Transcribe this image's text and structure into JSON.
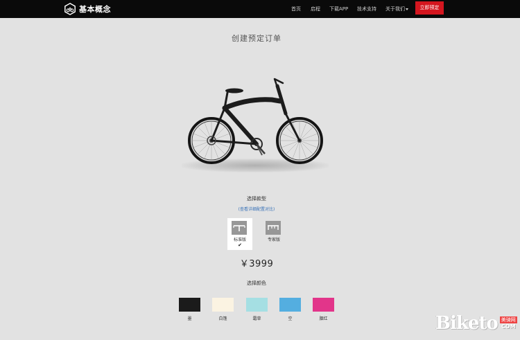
{
  "brand": {
    "name": "基本概念"
  },
  "nav": {
    "items": [
      "首页",
      "启程",
      "下载APP",
      "技术支持",
      "关于我们"
    ],
    "preorder_button": "立即预定"
  },
  "page": {
    "title": "创建预定订单",
    "model_section_label": "选择款型",
    "compare_link": "(查看详细配置对比)",
    "versions": [
      {
        "label": "标准版",
        "selected": true,
        "check": "✔"
      },
      {
        "label": "专家版",
        "selected": false
      }
    ],
    "price": "￥3999",
    "color_section_label": "选择颜色",
    "colors": [
      {
        "label": "墨",
        "hex": "#1b1b1b"
      },
      {
        "label": "白篷",
        "hex": "#fbf3e2"
      },
      {
        "label": "霜草",
        "hex": "#a5dfe3"
      },
      {
        "label": "空",
        "hex": "#54aee0"
      },
      {
        "label": "胭红",
        "hex": "#e2358a"
      }
    ]
  },
  "watermark": {
    "text": "Biketo",
    "cn": "美骑网",
    "com": "COM"
  },
  "colors": {
    "nav_bg": "#0a0a0a",
    "accent": "#d4161f",
    "page_bg": "#e2e2e2",
    "link": "#3a73b8"
  }
}
